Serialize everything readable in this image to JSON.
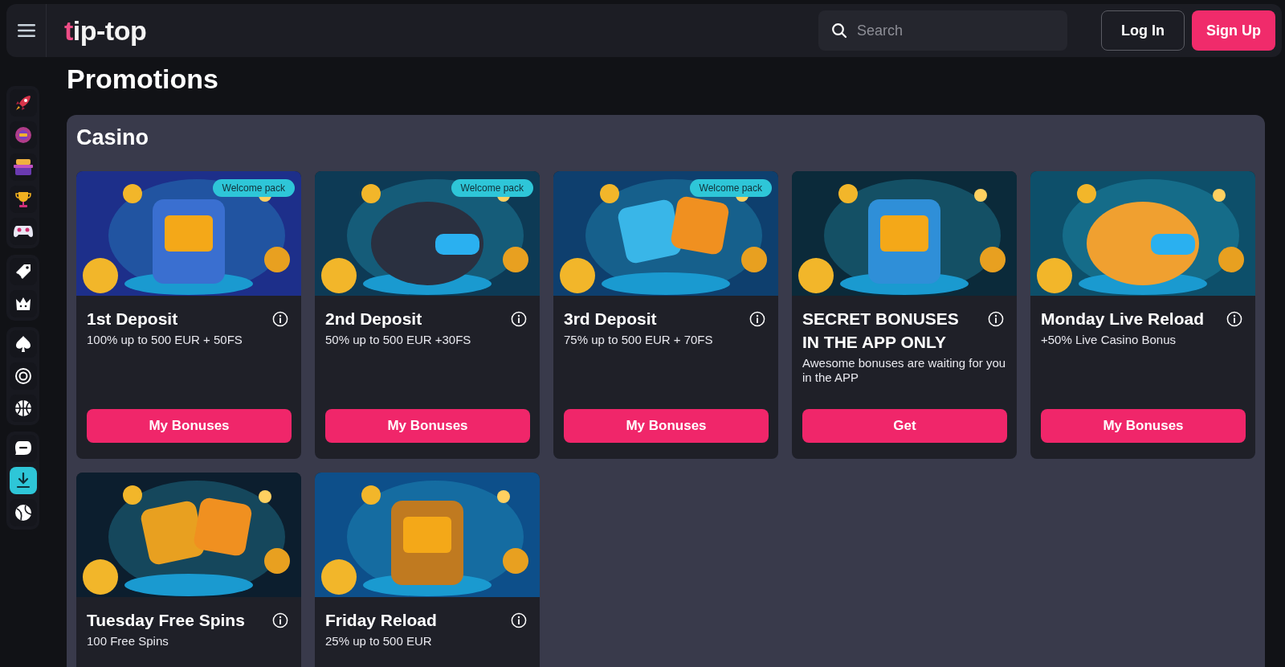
{
  "header": {
    "logo": {
      "accent": "t",
      "rest": "ip-top"
    },
    "search": {
      "placeholder": "Search"
    },
    "buttons": [
      {
        "label": "Log In",
        "kind": "outline"
      },
      {
        "label": "Sign Up",
        "kind": "primary"
      }
    ]
  },
  "page_title": "Promotions",
  "section": {
    "title": "Casino",
    "cards": [
      {
        "kind": "picture",
        "badge": "Welcome pack",
        "title": "1st Deposit",
        "description": "100% up to 500 EUR + 50FS",
        "button": "My Bonuses"
      },
      {
        "kind": "picture",
        "badge": "Welcome pack",
        "title": "2nd Deposit",
        "description": "50% up to 500 EUR +30FS",
        "button": "My Bonuses"
      },
      {
        "kind": "picture",
        "badge": "Welcome pack",
        "title": "3rd Deposit",
        "description": "75% up to 500 EUR + 70FS",
        "button": "My Bonuses"
      },
      {
        "kind": "picture",
        "title": "SECRET BONUSES IN THE APP ONLY",
        "description": "Awesome bonuses are waiting for you in the APP",
        "button": "Get"
      },
      {
        "kind": "picture",
        "title": "Monday Live Reload",
        "description": "+50% Live Casino Bonus",
        "button": "My Bonuses"
      },
      {
        "kind": "picture",
        "title": "Tuesday Free Spins",
        "description": "100 Free Spins"
      },
      {
        "kind": "picture",
        "title": "Friday Reload",
        "description": "25% up to 500 EUR"
      }
    ]
  }
}
